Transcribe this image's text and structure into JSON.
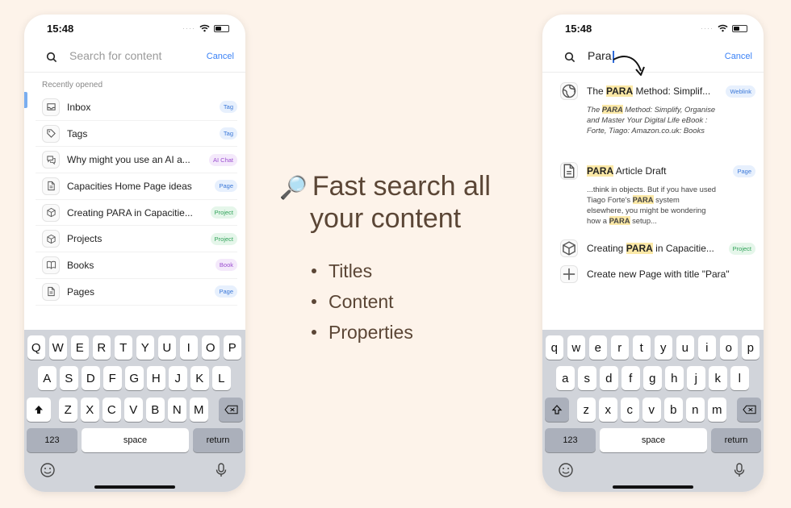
{
  "left_phone": {
    "time": "15:48",
    "search": {
      "placeholder": "Search for content",
      "cancel": "Cancel"
    },
    "section_label": "Recently opened",
    "items": [
      {
        "label": "Inbox",
        "icon": "inbox-icon",
        "tag": "Tag",
        "tag_color": "blue"
      },
      {
        "label": "Tags",
        "icon": "tag-icon",
        "tag": "Tag",
        "tag_color": "blue"
      },
      {
        "label": "Why might you use an AI a...",
        "icon": "chat-icon",
        "tag": "AI Chat",
        "tag_color": "purple"
      },
      {
        "label": "Capacities Home Page ideas",
        "icon": "page-icon",
        "tag": "Page",
        "tag_color": "blue"
      },
      {
        "label": "Creating PARA in Capacitie...",
        "icon": "cube-icon",
        "tag": "Project",
        "tag_color": "green"
      },
      {
        "label": "Projects",
        "icon": "cube-icon",
        "tag": "Project",
        "tag_color": "green"
      },
      {
        "label": "Books",
        "icon": "book-icon",
        "tag": "Book",
        "tag_color": "purple"
      },
      {
        "label": "Pages",
        "icon": "page-icon",
        "tag": "Page",
        "tag_color": "blue"
      }
    ],
    "keyboard": {
      "row1": [
        "Q",
        "W",
        "E",
        "R",
        "T",
        "Y",
        "U",
        "I",
        "O",
        "P"
      ],
      "row2": [
        "A",
        "S",
        "D",
        "F",
        "G",
        "H",
        "J",
        "K",
        "L"
      ],
      "row3": [
        "Z",
        "X",
        "C",
        "V",
        "B",
        "N",
        "M"
      ],
      "numbers": "123",
      "space": "space",
      "return": "return"
    }
  },
  "center": {
    "icon": "🔎",
    "headline_line1": "Fast search all",
    "headline_line2": "your content",
    "bullets": [
      "Titles",
      "Content",
      "Properties"
    ]
  },
  "right_phone": {
    "time": "15:48",
    "search": {
      "value": "Para",
      "cancel": "Cancel"
    },
    "results": [
      {
        "pre": "The ",
        "hl": "PARA",
        "post": " Method: Simplif...",
        "icon": "globe-icon",
        "tag": "Weblink",
        "tag_color": "blue",
        "desc": "The PARA Method: Simplify, Organise and Master Your Digital Life eBook : Forte, Tiago: Amazon.co.uk: Books"
      },
      {
        "pre": "",
        "hl": "PARA",
        "post": " Article Draft",
        "icon": "page-icon",
        "tag": "Page",
        "tag_color": "blue",
        "desc": "...think in objects. But if you have used Tiago Forte's PARA system elsewhere, you might be wondering how a PARA setup..."
      },
      {
        "pre": "Creating ",
        "hl": "PARA",
        "post": " in Capacitie...",
        "icon": "cube-icon",
        "tag": "Project",
        "tag_color": "green"
      },
      {
        "label": "Create new Page with title \"Para\"",
        "icon": "plus-icon"
      }
    ],
    "keyboard": {
      "row1": [
        "q",
        "w",
        "e",
        "r",
        "t",
        "y",
        "u",
        "i",
        "o",
        "p"
      ],
      "row2": [
        "a",
        "s",
        "d",
        "f",
        "g",
        "h",
        "j",
        "k",
        "l"
      ],
      "row3": [
        "z",
        "x",
        "c",
        "v",
        "b",
        "n",
        "m"
      ],
      "numbers": "123",
      "space": "space",
      "return": "return"
    }
  },
  "colors": {
    "background": "#fdf3ea",
    "headline": "#5b4636",
    "accent": "#3b82f6",
    "highlight": "#fbe8a6"
  }
}
